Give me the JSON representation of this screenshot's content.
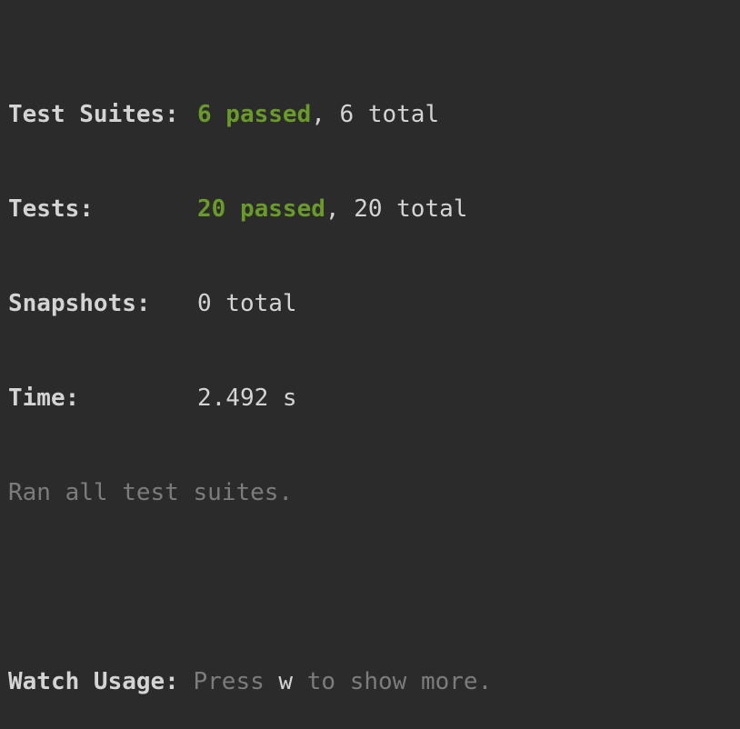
{
  "summary": {
    "suites_label": "Test Suites:",
    "suites_passed": "6 passed",
    "suites_total": ", 6 total",
    "tests_label": "Tests:",
    "tests_passed": "20 passed",
    "tests_total": ", 20 total",
    "snapshots_label": "Snapshots:",
    "snapshots_total": "0 total",
    "time_label": "Time:",
    "time_value": "2.492 s",
    "ran_all": "Ran all test suites."
  },
  "watch": {
    "label": "Watch Usage:",
    "press": " Press ",
    "key": "w",
    "rest": " to show more."
  },
  "colors": {
    "background": "#2b2b2b",
    "text": "#d4d4d4",
    "passed": "#6a9a2a",
    "dim": "#7c7c7c"
  }
}
